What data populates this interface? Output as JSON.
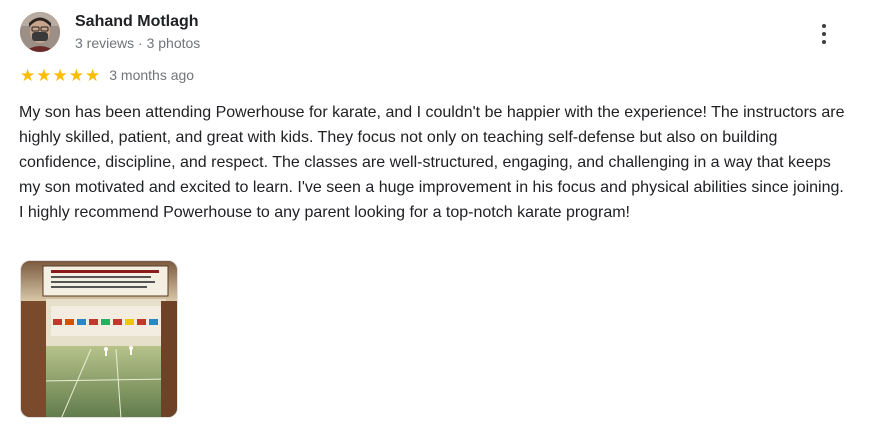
{
  "reviewer": {
    "name": "Sahand Motlagh",
    "stats": "3 reviews · 3 photos",
    "avatar_icon": "profile-photo"
  },
  "review": {
    "rating": 5,
    "stars": [
      "★",
      "★",
      "★",
      "★",
      "★"
    ],
    "star_color": "#fbbc04",
    "date": "3 months ago",
    "text": "My son has been attending Powerhouse for karate, and I couldn't be happier with the experience! The instructors are highly skilled, patient, and great with kids. They focus not only on teaching self-defense but also on building confidence, discipline, and respect. The classes are well-structured, engaging, and challenging in a way that keeps my son motivated and excited to learn. I've seen a huge improvement in his focus and physical abilities since joining. I highly recommend Powerhouse to any parent looking for a top-notch karate program!"
  },
  "photos": [
    {
      "icon": "dojo-interior-photo"
    }
  ],
  "menu": {
    "icon": "more-vert-icon"
  }
}
